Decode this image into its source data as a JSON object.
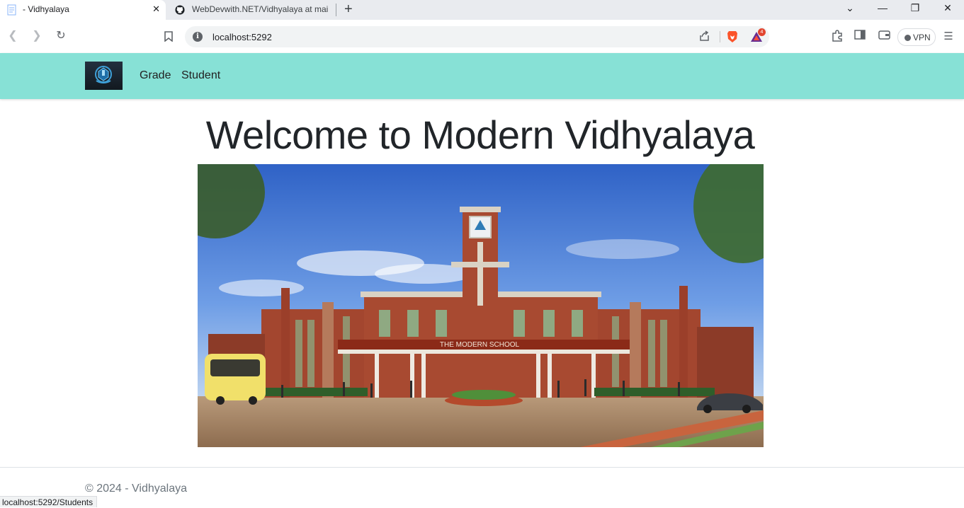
{
  "browser": {
    "tabs": [
      {
        "title": "- Vidhyalaya",
        "active": true
      },
      {
        "title": "WebDevwith.NET/Vidhyalaya at mai",
        "active": false
      }
    ],
    "url": "localhost:5292",
    "vpn_label": "VPN",
    "rewards_badge": "4",
    "status_url": "localhost:5292/Students"
  },
  "nav": {
    "links": [
      "Grade",
      "Student"
    ]
  },
  "main": {
    "heading": "Welcome to Modern Vidhyalaya",
    "image_sign": "THE MODERN SCHOOL"
  },
  "footer": {
    "text": "© 2024 - Vidhyalaya"
  },
  "colors": {
    "nav_bg": "#87e1d6",
    "heading": "#212529",
    "footer_text": "#6c757d"
  }
}
